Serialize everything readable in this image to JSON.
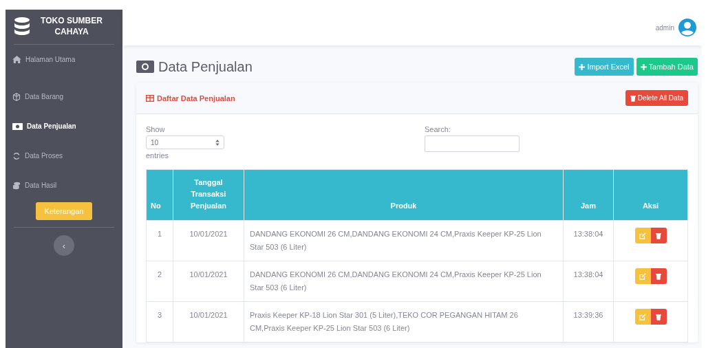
{
  "brand": {
    "name": "TOKO SUMBER CAHAYA"
  },
  "sidebar": {
    "items": [
      {
        "label": "Halaman Utama",
        "selected": false
      },
      {
        "label": "Data Barang",
        "selected": false
      },
      {
        "label": "Data Penjualan",
        "selected": true
      },
      {
        "label": "Data Proses",
        "selected": false
      },
      {
        "label": "Data Hasil",
        "selected": false
      }
    ],
    "button": "Keterangan",
    "toggle": "‹"
  },
  "topbar": {
    "user": "admin"
  },
  "page": {
    "title": "Data Penjualan",
    "buttons": [
      {
        "label": "Import Excel",
        "kind": "info"
      },
      {
        "label": "Tambah Data",
        "kind": "success"
      }
    ]
  },
  "card": {
    "title": "Daftar Data Penjualan",
    "delete_button": "Delete All Data",
    "length": {
      "label": "Show",
      "value": "10",
      "suffix": "entries"
    },
    "search": {
      "label": "Search:"
    },
    "table": {
      "columns": [
        "No",
        "Tanggal Transaksi Penjualan",
        "Produk",
        "Jam",
        "Aksi"
      ],
      "rows": [
        {
          "no": "1",
          "date": "10/01/2021",
          "product": "DANDANG EKONOMI 26 CM,DANDANG EKONOMI 24 CM,Praxis Keeper KP-25 Lion Star 503 (6 Liter)",
          "time": "13:38:04"
        },
        {
          "no": "2",
          "date": "10/01/2021",
          "product": "DANDANG EKONOMI 26 CM,DANDANG EKONOMI 24 CM,Praxis Keeper KP-25 Lion Star 503 (6 Liter)",
          "time": "13:38:04"
        },
        {
          "no": "3",
          "date": "10/01/2021",
          "product": "Praxis Keeper KP-18 Lion Star 301 (5 Liter),TEKO COR PEGANGAN HITAM 26 CM,Praxis Keeper KP-25 Lion Star 503 (6 Liter)",
          "time": "13:39:36"
        }
      ]
    }
  }
}
